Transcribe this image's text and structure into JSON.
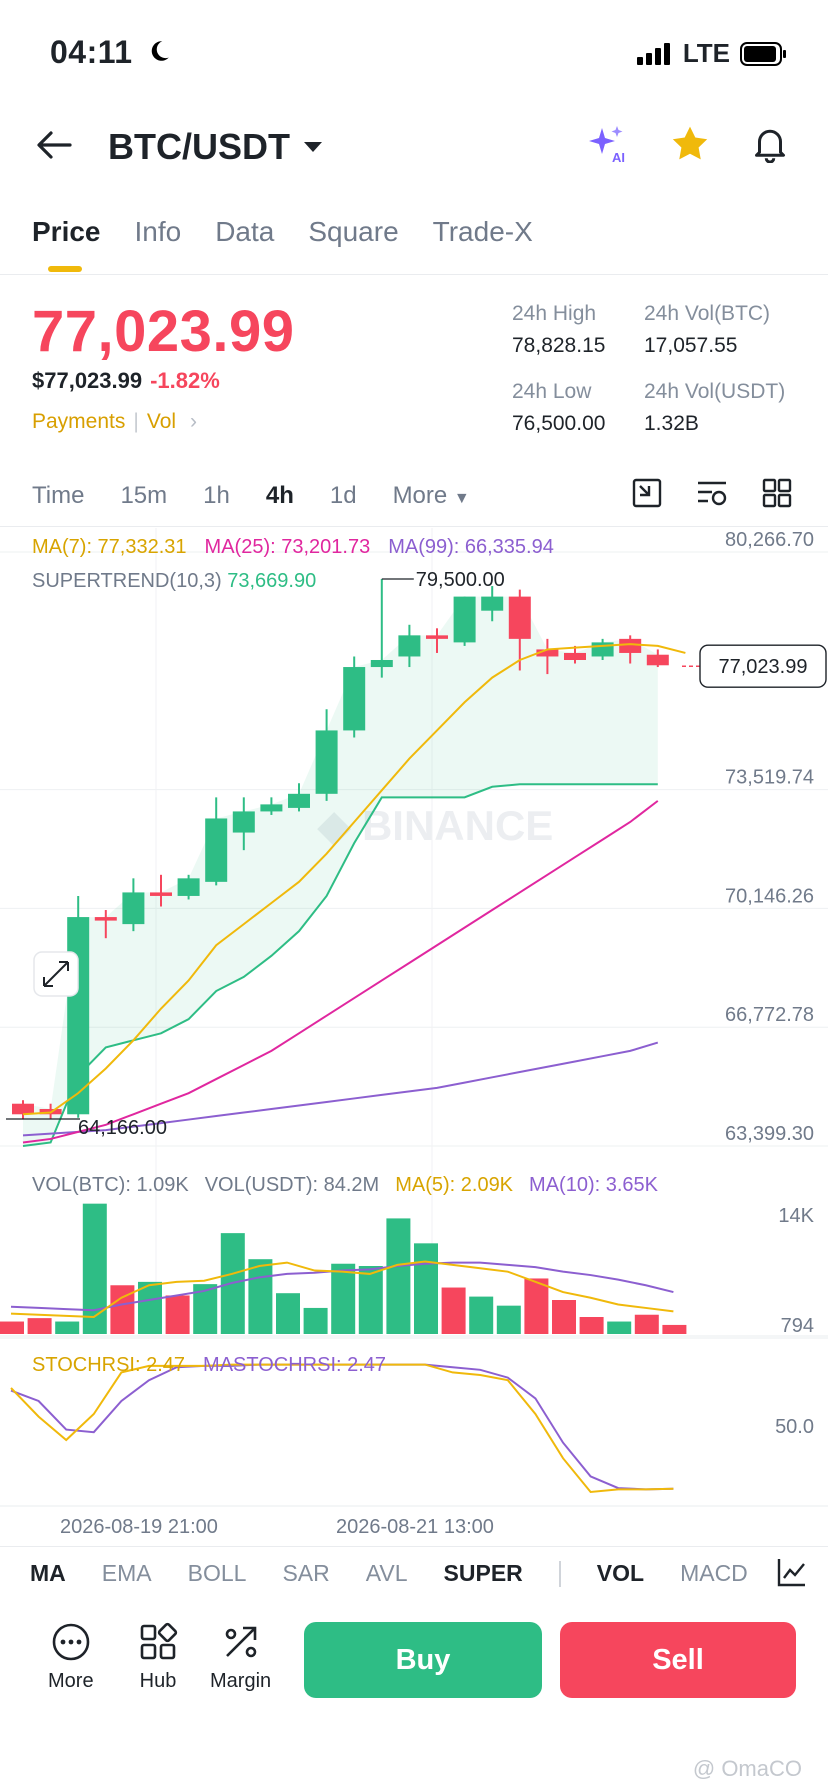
{
  "status": {
    "time": "04:11",
    "network": "LTE"
  },
  "header": {
    "pair": "BTC/USDT"
  },
  "tabs": [
    "Price",
    "Info",
    "Data",
    "Square",
    "Trade-X"
  ],
  "price": {
    "last": "77,023.99",
    "usd": "$77,023.99",
    "change": "-1.82%",
    "tag1": "Payments",
    "tag2": "Vol",
    "high_label": "24h High",
    "high": "78,828.15",
    "low_label": "24h Low",
    "low": "76,500.00",
    "volbtc_label": "24h Vol(BTC)",
    "volbtc": "17,057.55",
    "volusdt_label": "24h Vol(USDT)",
    "volusdt": "1.32B"
  },
  "intervals": [
    "Time",
    "15m",
    "1h",
    "4h",
    "1d",
    "More"
  ],
  "indicators_text": {
    "ma7": "MA(7): 77,332.31",
    "ma25": "MA(25): 73,201.73",
    "ma99": "MA(99): 66,335.94",
    "st_label": "SUPERTREND(10,3)",
    "st_value": "73,669.90",
    "vol_btc": "VOL(BTC): 1.09K",
    "vol_usdt": "VOL(USDT): 84.2M",
    "vol_ma5": "MA(5): 2.09K",
    "vol_ma10": "MA(10): 3.65K",
    "stoch": "STOCHRSI: 2.47",
    "mastoch": "MASTOCHRSI: 2.47"
  },
  "colors": {
    "up": "#2ebd85",
    "down": "#f6465d",
    "ma7": "#f0b90b",
    "ma25": "#e0279f",
    "ma99": "#8c5fd0",
    "accent": "#f0b90b"
  },
  "chart_data": {
    "type": "candlestick",
    "price_axis_ticks": [
      "80,266.70",
      "73,519.74",
      "70,146.26",
      "66,772.78",
      "63,399.30"
    ],
    "price_tick_values": [
      80266.7,
      73519.74,
      70146.26,
      66772.78,
      63399.3
    ],
    "ylim": [
      63399.3,
      80266.7
    ],
    "last_price_label": "77,023.99",
    "last_price": 77023.99,
    "high_marker": {
      "label": "79,500.00",
      "value": 79500
    },
    "low_marker": {
      "label": "64,166.00",
      "value": 64166
    },
    "x_labels": [
      "2026-08-19 21:00",
      "2026-08-21 13:00"
    ],
    "candles": [
      {
        "o": 64600,
        "h": 64700,
        "l": 64150,
        "c": 64300
      },
      {
        "o": 64450,
        "h": 64600,
        "l": 64166,
        "c": 64300
      },
      {
        "o": 64300,
        "h": 70500,
        "l": 64200,
        "c": 69900
      },
      {
        "o": 69900,
        "h": 70100,
        "l": 69300,
        "c": 69800
      },
      {
        "o": 69700,
        "h": 71000,
        "l": 69500,
        "c": 70600
      },
      {
        "o": 70600,
        "h": 71100,
        "l": 70200,
        "c": 70500
      },
      {
        "o": 70500,
        "h": 71100,
        "l": 70400,
        "c": 71000
      },
      {
        "o": 70900,
        "h": 73300,
        "l": 70800,
        "c": 72700
      },
      {
        "o": 72300,
        "h": 73300,
        "l": 71800,
        "c": 72900
      },
      {
        "o": 72900,
        "h": 73300,
        "l": 72800,
        "c": 73100
      },
      {
        "o": 73000,
        "h": 73700,
        "l": 72900,
        "c": 73400
      },
      {
        "o": 73400,
        "h": 75800,
        "l": 73200,
        "c": 75200
      },
      {
        "o": 75200,
        "h": 77300,
        "l": 75000,
        "c": 77000
      },
      {
        "o": 77000,
        "h": 79500,
        "l": 76700,
        "c": 77200
      },
      {
        "o": 77300,
        "h": 78200,
        "l": 77000,
        "c": 77900
      },
      {
        "o": 77900,
        "h": 78100,
        "l": 77400,
        "c": 77800
      },
      {
        "o": 77700,
        "h": 79000,
        "l": 77600,
        "c": 79000
      },
      {
        "o": 78600,
        "h": 79300,
        "l": 78300,
        "c": 79000
      },
      {
        "o": 79000,
        "h": 79200,
        "l": 76900,
        "c": 77800
      },
      {
        "o": 77500,
        "h": 77800,
        "l": 76800,
        "c": 77300
      },
      {
        "o": 77400,
        "h": 77600,
        "l": 77100,
        "c": 77200
      },
      {
        "o": 77300,
        "h": 77800,
        "l": 77200,
        "c": 77700
      },
      {
        "o": 77800,
        "h": 77900,
        "l": 77100,
        "c": 77400
      },
      {
        "o": 77350,
        "h": 77500,
        "l": 77000,
        "c": 77050
      }
    ],
    "ma7": [
      64300,
      64350,
      64900,
      65600,
      66400,
      67300,
      68100,
      69100,
      69700,
      70300,
      70900,
      71700,
      72600,
      73500,
      74400,
      75200,
      76000,
      76700,
      77200,
      77500,
      77550,
      77600,
      77650,
      77600,
      77400
    ],
    "ma25": [
      63500,
      63600,
      63800,
      64000,
      64300,
      64600,
      64900,
      65300,
      65700,
      66100,
      66600,
      67100,
      67600,
      68100,
      68600,
      69100,
      69600,
      70100,
      70600,
      71100,
      71600,
      72100,
      72600,
      73200
    ],
    "ma99": [
      63700,
      63750,
      63800,
      63850,
      63950,
      64050,
      64150,
      64250,
      64350,
      64450,
      64550,
      64650,
      64750,
      64850,
      64950,
      65050,
      65200,
      65350,
      65500,
      65650,
      65800,
      65950,
      66100,
      66335.94
    ],
    "supertrend": [
      63400,
      63500,
      65400,
      66200,
      66400,
      66600,
      67000,
      67800,
      68200,
      68800,
      69500,
      70500,
      72000,
      73300,
      73300,
      73300,
      73300,
      73600,
      73669.9,
      73669.9,
      73669.9,
      73669.9,
      73669.9,
      73669.9
    ],
    "volume_axis_ticks": [
      "14K",
      "794"
    ],
    "volume": [
      1100,
      1400,
      1100,
      11500,
      4300,
      4600,
      3400,
      4400,
      8900,
      6600,
      3600,
      2300,
      6200,
      6000,
      10200,
      8000,
      4100,
      3300,
      2500,
      4900,
      3000,
      1500,
      1100,
      1700,
      800
    ],
    "volume_up": [
      false,
      false,
      true,
      true,
      false,
      true,
      false,
      true,
      true,
      true,
      true,
      true,
      true,
      true,
      true,
      true,
      false,
      true,
      true,
      false,
      false,
      false,
      true,
      false,
      false
    ],
    "vol_ma5": [
      1800,
      1700,
      1600,
      1500,
      3200,
      4300,
      4600,
      4700,
      5300,
      6000,
      6300,
      5600,
      5500,
      5300,
      6100,
      6400,
      6100,
      5800,
      5500,
      4600,
      3700,
      3200,
      2600,
      2300,
      2000
    ],
    "vol_ma10": [
      2400,
      2300,
      2200,
      2100,
      2600,
      3000,
      3400,
      3800,
      4500,
      5000,
      5300,
      5400,
      5600,
      5700,
      6000,
      6200,
      6300,
      6300,
      6100,
      5900,
      5500,
      5200,
      4800,
      4300,
      3700
    ],
    "stoch_axis_ticks": [
      "50.0"
    ],
    "stochrsi": [
      80,
      58,
      40,
      60,
      92,
      97,
      97,
      97,
      98,
      98,
      98,
      98,
      98,
      98,
      98,
      98,
      92,
      90,
      86,
      60,
      26,
      0,
      2,
      2,
      2.47
    ],
    "mastochrsi": [
      78,
      70,
      48,
      46,
      70,
      86,
      96,
      97,
      97,
      98,
      98,
      98,
      98,
      98,
      98,
      98,
      96,
      94,
      88,
      72,
      38,
      12,
      3,
      2,
      2.47
    ]
  },
  "indicator_tabs": [
    "MA",
    "EMA",
    "BOLL",
    "SAR",
    "AVL",
    "SUPER",
    "VOL",
    "MACD"
  ],
  "bottom": {
    "more": "More",
    "hub": "Hub",
    "margin": "Margin",
    "buy": "Buy",
    "sell": "Sell"
  },
  "watermark": "@ OmaCO"
}
